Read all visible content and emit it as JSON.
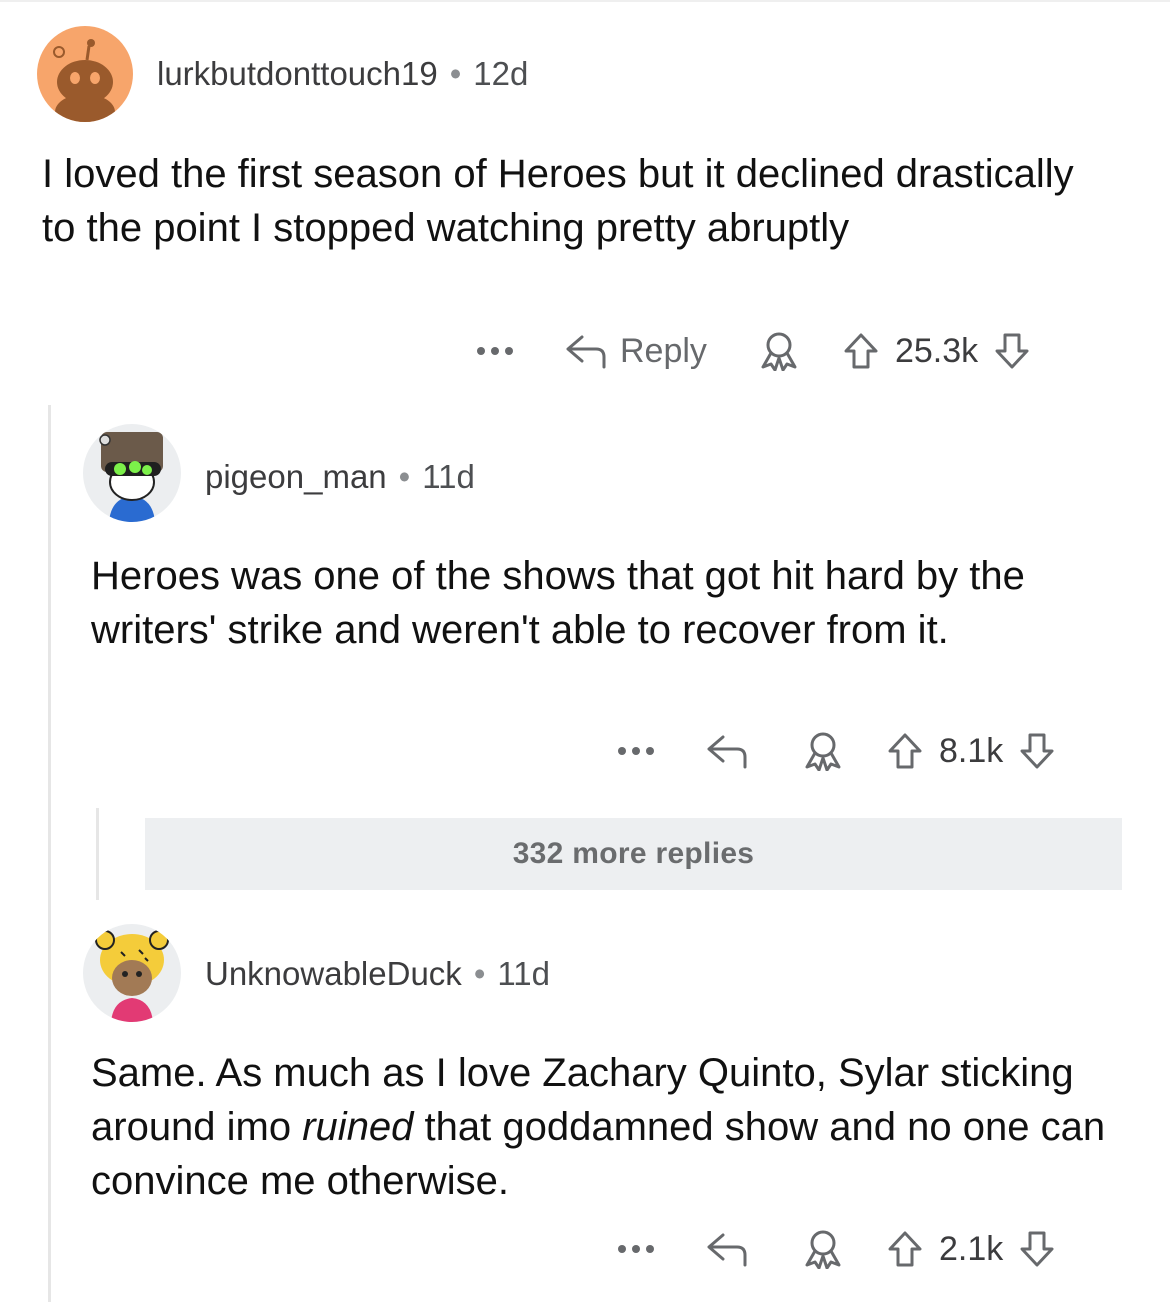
{
  "comments": [
    {
      "username": "lurkbutdonttouch19",
      "age": "12d",
      "body": "I loved the first season of Heroes but it declined drastically to the point I stopped watching pretty abruptly",
      "reply_label": "Reply",
      "score": "25.3k"
    },
    {
      "username": "pigeon_man",
      "age": "11d",
      "body": "Heroes was one of the shows that got hit hard by the writers' strike and weren't able to recover from it.",
      "score": "8.1k"
    },
    {
      "username": "UnknowableDuck",
      "age": "11d",
      "body_part1": "Same. As much as I love Zachary Quinto, Sylar sticking around imo ",
      "body_emphasis": "ruined",
      "body_part2": " that goddamned show and no one can convince me otherwise.",
      "score": "2.1k"
    }
  ],
  "more_replies": "332 more replies",
  "icons": {
    "more": "more-options-icon",
    "reply": "reply-arrow-icon",
    "award": "award-icon",
    "upvote": "upvote-icon",
    "downvote": "downvote-icon"
  },
  "colors": {
    "avatar1_bg": "#f7a56b",
    "avatar_neutral_bg": "#eceef0",
    "more_replies_bg": "#edeff1",
    "icon": "#67696c"
  }
}
